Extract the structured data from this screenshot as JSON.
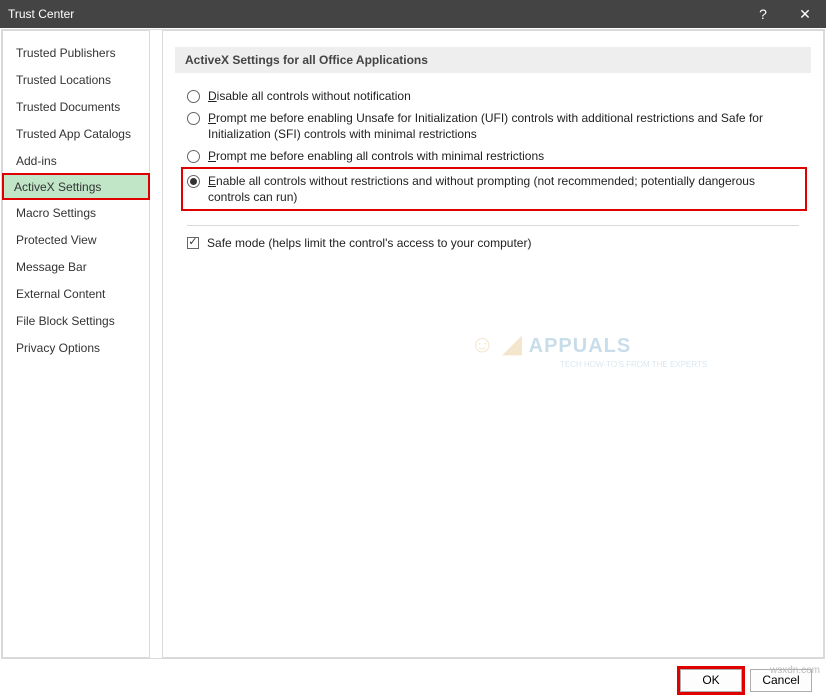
{
  "titlebar": {
    "title": "Trust Center",
    "help": "?",
    "close": "✕"
  },
  "sidebar": {
    "items": [
      {
        "label": "Trusted Publishers"
      },
      {
        "label": "Trusted Locations"
      },
      {
        "label": "Trusted Documents"
      },
      {
        "label": "Trusted App Catalogs"
      },
      {
        "label": "Add-ins"
      },
      {
        "label": "ActiveX Settings",
        "selected": true
      },
      {
        "label": "Macro Settings"
      },
      {
        "label": "Protected View"
      },
      {
        "label": "Message Bar"
      },
      {
        "label": "External Content"
      },
      {
        "label": "File Block Settings"
      },
      {
        "label": "Privacy Options"
      }
    ]
  },
  "section": {
    "header": "ActiveX Settings for all Office Applications"
  },
  "radios": [
    {
      "pre": "D",
      "text": "isable all controls without notification",
      "checked": false
    },
    {
      "pre": "P",
      "text": "rompt me before enabling Unsafe for Initialization (UFI) controls with additional restrictions and Safe for Initialization (SFI) controls with minimal restrictions",
      "checked": false
    },
    {
      "pre": "P",
      "text": "rompt me before enabling all controls with minimal restrictions",
      "checked": false
    },
    {
      "pre": "E",
      "text": "nable all controls without restrictions and without prompting (not recommended; potentially dangerous controls can run)",
      "checked": true,
      "highlight": true
    }
  ],
  "checkbox": {
    "label_pre": "S",
    "label": "afe mode (helps limit the control's access to your computer)",
    "checked": true
  },
  "buttons": {
    "ok": "OK",
    "cancel": "Cancel"
  },
  "watermark": {
    "brand": "APPUALS",
    "tag": "TECH HOW-TO'S FROM THE EXPERTS",
    "footer": "wsxdn.com"
  }
}
